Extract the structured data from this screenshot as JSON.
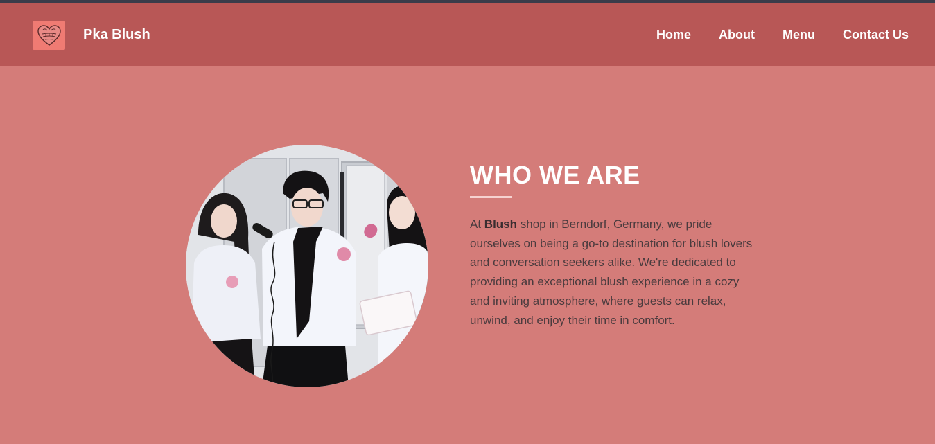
{
  "header": {
    "brand": "Pka Blush",
    "logo_icon": "heart-blush-icon",
    "nav": [
      {
        "label": "Home"
      },
      {
        "label": "About"
      },
      {
        "label": "Menu"
      },
      {
        "label": "Contact Us"
      }
    ]
  },
  "about": {
    "title": "WHO WE ARE",
    "text_before": "At ",
    "highlight": "Blush",
    "text_after": " shop in Berndorf, Germany, we pride ourselves on being a go-to destination for blush lovers and conversation seekers alike. We're dedicated to providing an exceptional blush experience in a cozy and inviting atmosphere, where guests can relax, unwind, and enjoy their time in comfort."
  },
  "colors": {
    "page_background": "#d47c79",
    "navbar_background": "#b85756",
    "top_strip": "#3a3c4a",
    "logo_background": "#f07b73",
    "accent_underline": "#f6d2d0",
    "body_text": "#4a3b3e"
  }
}
